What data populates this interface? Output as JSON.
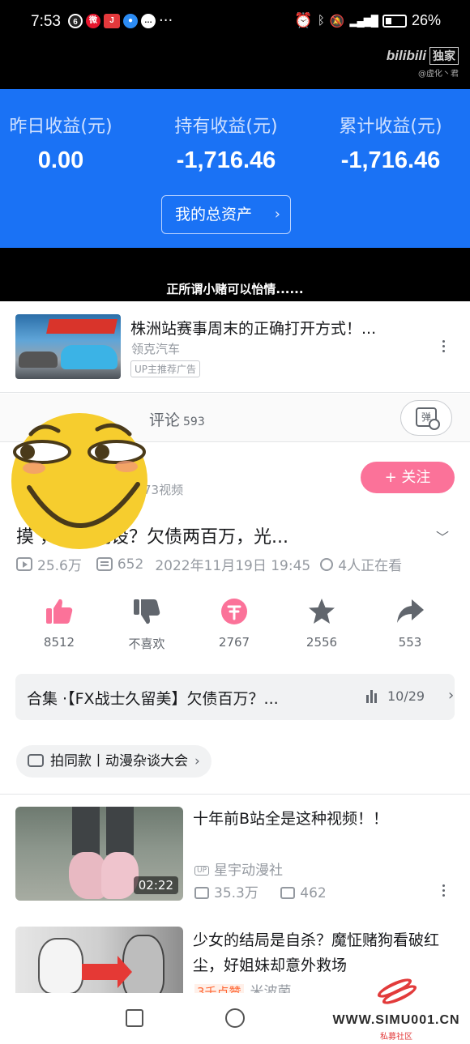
{
  "status_bar": {
    "time": "7:53",
    "battery": "26%",
    "more": "···"
  },
  "watermark": {
    "logo": "bilibili",
    "badge": "独家",
    "user": "@虚化丶君"
  },
  "fund": {
    "columns": [
      {
        "label": "昨日收益(元)",
        "value": "0.00"
      },
      {
        "label": "持有收益(元)",
        "value": "-1,716.46"
      },
      {
        "label": "累计收益(元)",
        "value": "-1,716.46"
      }
    ],
    "button": "我的总资产"
  },
  "subtitle": "正所谓小赌可以怡情......",
  "ad": {
    "title": "株洲站赛事周末的正确打开方式！...",
    "brand": "领克汽车",
    "tag": "UP主推荐广告"
  },
  "tabs": {
    "comments_label": "评论",
    "comments_count": "593",
    "danmaku_icon": "弹"
  },
  "uploader": {
    "videos": "73视频",
    "follow": "+ 关注"
  },
  "video": {
    "title": "摸        ，天造地设？欠债两百万，光...",
    "views": "25.6万",
    "danmaku": "652",
    "date": "2022年11月19日 19:45",
    "watching": "4人正在看"
  },
  "actions": [
    {
      "name": "like",
      "count": "8512"
    },
    {
      "name": "dislike",
      "count": "不喜欢"
    },
    {
      "name": "coin",
      "count": "2767"
    },
    {
      "name": "favorite",
      "count": "2556"
    },
    {
      "name": "share",
      "count": "553"
    }
  ],
  "collection": {
    "title": "合集 ·【FX战士久留美】欠债百万？...",
    "progress": "10/29"
  },
  "topic": "拍同款丨动漫杂谈大会",
  "recommendations": [
    {
      "title": "十年前B站全是这种视频！！",
      "duration": "02:22",
      "author": "星宇动漫社",
      "views": "35.3万",
      "danmaku": "462"
    },
    {
      "title": "少女的结局是自杀？魔怔赌狗看破红尘，好姐妹却意外救场",
      "hot": "3千点赞",
      "author": "米波菌"
    }
  ],
  "site_watermark": {
    "url": "WWW.SIMU001.CN",
    "name": "私募社区"
  },
  "colors": {
    "fund_blue": "#1a72f5",
    "bili_pink": "#fb7299",
    "hot_orange": "#ff6633"
  }
}
